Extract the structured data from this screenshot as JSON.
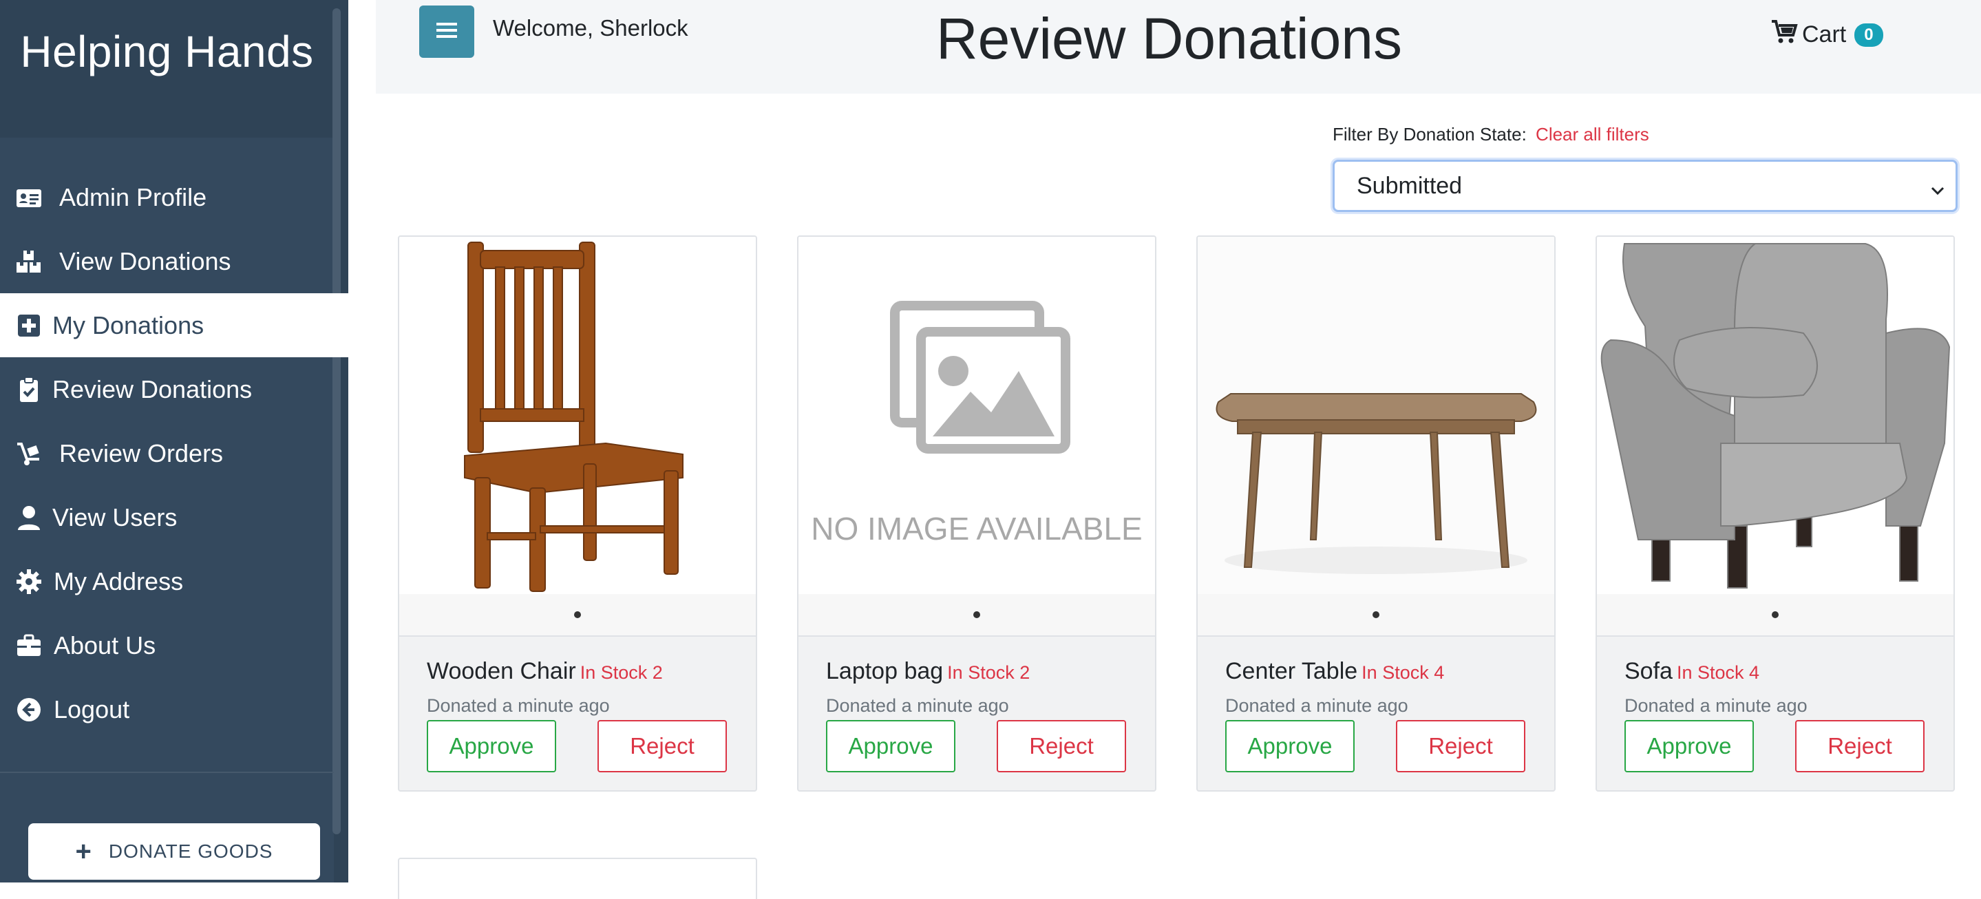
{
  "sidebar": {
    "brand": "Helping Hands",
    "items": [
      {
        "label": "Admin Profile",
        "icon": "id-card-icon"
      },
      {
        "label": "View Donations",
        "icon": "boxes-icon"
      },
      {
        "label": "My Donations",
        "icon": "plus-square-icon",
        "active": true
      },
      {
        "label": "Review Donations",
        "icon": "clipboard-check-icon"
      },
      {
        "label": "Review Orders",
        "icon": "dolly-icon"
      },
      {
        "label": "View Users",
        "icon": "user-icon"
      },
      {
        "label": "My Address",
        "icon": "gear-icon"
      },
      {
        "label": "About Us",
        "icon": "briefcase-icon"
      },
      {
        "label": "Logout",
        "icon": "arrow-circle-left-icon"
      }
    ],
    "donate_button": "DONATE GOODS"
  },
  "header": {
    "welcome": "Welcome, Sherlock",
    "title": "Review Donations",
    "cart_label": "Cart",
    "cart_count": "0"
  },
  "filter": {
    "label": "Filter By Donation State:",
    "clear_label": "Clear all filters",
    "selected": "Submitted"
  },
  "donations": [
    {
      "name": "Wooden Chair",
      "stock": "In Stock 2",
      "donated": "Donated a minute ago",
      "approve": "Approve",
      "reject": "Reject",
      "image": "wooden-chair"
    },
    {
      "name": "Laptop bag",
      "stock": "In Stock 2",
      "donated": "Donated a minute ago",
      "approve": "Approve",
      "reject": "Reject",
      "image": "no-image-placeholder",
      "placeholder_text": "NO IMAGE AVAILABLE"
    },
    {
      "name": "Center Table",
      "stock": "In Stock 4",
      "donated": "Donated a minute ago",
      "approve": "Approve",
      "reject": "Reject",
      "image": "center-table"
    },
    {
      "name": "Sofa",
      "stock": "In Stock 4",
      "donated": "Donated a minute ago",
      "approve": "Approve",
      "reject": "Reject",
      "image": "grey-armchair"
    }
  ],
  "colors": {
    "sidebar": "#34495e",
    "accent": "#3d8ea6",
    "approve": "#28a745",
    "reject": "#dc3545"
  }
}
